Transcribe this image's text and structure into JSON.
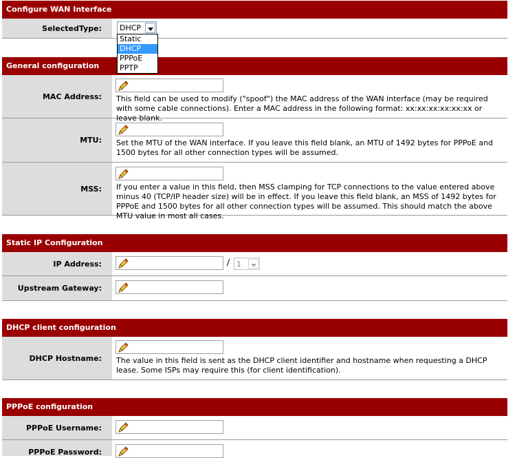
{
  "configure": {
    "title": "Configure WAN Interface",
    "selected_type_label": "SelectedType:",
    "selected_type_value": "DHCP",
    "options": [
      "Static",
      "DHCP",
      "PPPoE",
      "PPTP"
    ]
  },
  "general": {
    "title": "General configuration",
    "mac_label": "MAC Address:",
    "mac_desc": "This field can be used to modify (\"spoof\") the MAC address of the WAN interface (may be required with some cable connections). Enter a MAC address in the following format: xx:xx:xx:xx:xx:xx or leave blank.",
    "mtu_label": "MTU:",
    "mtu_desc": "Set the MTU of the WAN interface. If you leave this field blank, an MTU of 1492 bytes for PPPoE and 1500 bytes for all other connection types will be assumed.",
    "mss_label": "MSS:",
    "mss_desc": "If you enter a value in this field, then MSS clamping for TCP connections to the value entered above minus 40 (TCP/IP header size) will be in effect. If you leave this field blank, an MSS of 1492 bytes for PPPoE and 1500 bytes for all other connection types will be assumed. This should match the above MTU value in most all cases."
  },
  "static": {
    "title": "Static IP Configuration",
    "ip_label": "IP Address:",
    "slash": "/",
    "subnet_value": "1",
    "gateway_label": "Upstream Gateway:"
  },
  "dhcp": {
    "title": "DHCP client configuration",
    "hostname_label": "DHCP Hostname:",
    "hostname_desc": "The value in this field is sent as the DHCP client identifier and hostname when requesting a DHCP lease. Some ISPs may require this (for client identification)."
  },
  "pppoe": {
    "title": "PPPoE configuration",
    "username_label": "PPPoE Username:",
    "password_label": "PPPoE Password:"
  }
}
